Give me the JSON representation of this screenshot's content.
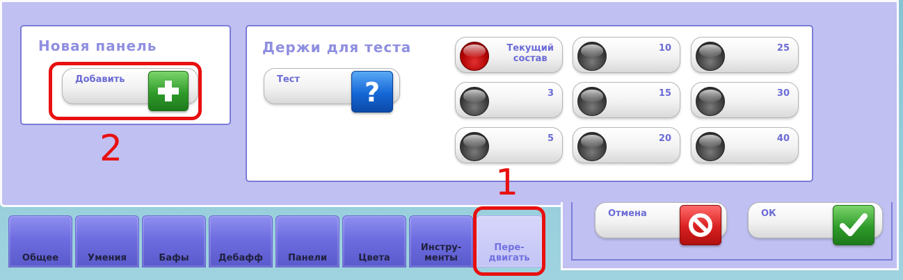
{
  "new_panel": {
    "title": "Новая панель",
    "add_label": "Добавить",
    "add_icon": "plus-icon"
  },
  "test_holders": {
    "title": "Держи для теста",
    "test_label": "Тест",
    "test_icon": "question-icon",
    "slots": [
      {
        "label": "Текущий\nсостав",
        "state": "active"
      },
      {
        "label": "10",
        "state": "inactive"
      },
      {
        "label": "25",
        "state": "inactive"
      },
      {
        "label": "3",
        "state": "inactive"
      },
      {
        "label": "15",
        "state": "inactive"
      },
      {
        "label": "30",
        "state": "inactive"
      },
      {
        "label": "5",
        "state": "inactive"
      },
      {
        "label": "20",
        "state": "inactive"
      },
      {
        "label": "40",
        "state": "inactive"
      }
    ]
  },
  "tabs": [
    {
      "label": "Общее"
    },
    {
      "label": "Умения"
    },
    {
      "label": "Бафы"
    },
    {
      "label": "Дебафф"
    },
    {
      "label": "Панели"
    },
    {
      "label": "Цвета"
    },
    {
      "label": "Инстру-\nменты"
    },
    {
      "label": "Пере-\nдвигать",
      "active": true
    }
  ],
  "actions": {
    "cancel_label": "Отмена",
    "ok_label": "ОК"
  },
  "annotations": {
    "marker_1": "1",
    "marker_2": "2"
  },
  "colors": {
    "panel_bg": "#c0c0f2",
    "accent_text": "#6b6bd6",
    "annotation": "#e81010"
  }
}
